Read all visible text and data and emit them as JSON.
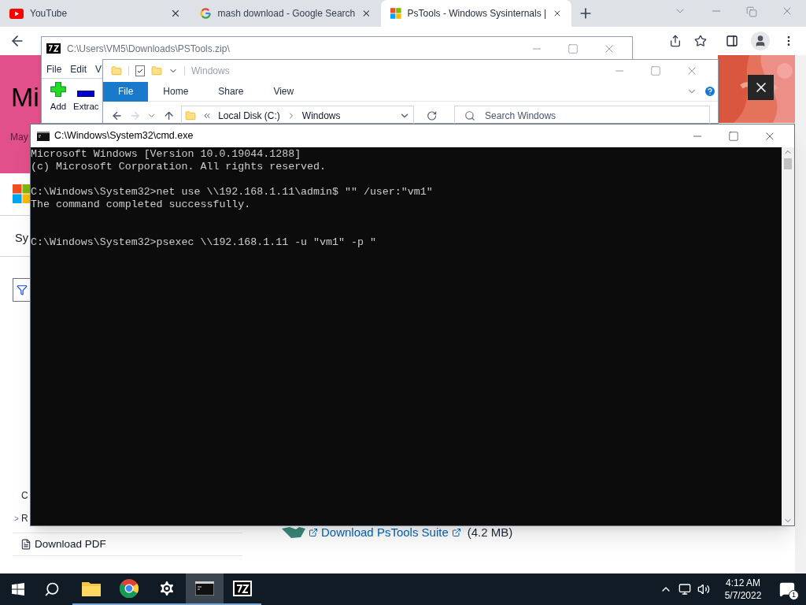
{
  "browser": {
    "tabs": [
      {
        "kind": "video",
        "title": "YouTube",
        "selected": false
      },
      {
        "kind": "search",
        "title": "mash download - Google Search",
        "selected": false
      },
      {
        "kind": "windows",
        "title": "PsTools - Windows Sysinternals |",
        "selected": true
      }
    ]
  },
  "page": {
    "heading": "Mi",
    "subtitle": "May",
    "section": "Sy",
    "nav_items": [
      {
        "label": "C"
      },
      {
        "marker": ">",
        "label": "R"
      }
    ],
    "download_pdf": "Download PDF",
    "download_link": "Download PsTools Suite",
    "download_size": "(4.2 MB)"
  },
  "zip_window": {
    "title": "C:\\Users\\VM5\\Downloads\\PSTools.zip\\",
    "menu": [
      "File",
      "Edit",
      "V"
    ],
    "toolbar": [
      {
        "kind": "add",
        "label": "Add"
      },
      {
        "kind": "extract",
        "label": "Extrac"
      }
    ]
  },
  "explorer": {
    "title": "Windows",
    "ribbon_tabs": [
      {
        "label": "File",
        "selected": true
      },
      {
        "label": "Home",
        "selected": false
      },
      {
        "label": "Share",
        "selected": false
      },
      {
        "label": "View",
        "selected": false
      }
    ],
    "breadcrumb": [
      "Local Disk (C:)",
      "Windows"
    ],
    "search": {
      "placeholder": "Search Windows"
    }
  },
  "console": {
    "title": "C:\\Windows\\System32\\cmd.exe",
    "output": "Microsoft Windows [Version 10.0.19044.1288]\n(c) Microsoft Corporation. All rights reserved.\n\nC:\\Windows\\System32>net use \\\\192.168.1.11\\admin$ \"\" /user:\"vm1\"\nThe command completed successfully.\n\n\nC:\\Windows\\System32>psexec \\\\192.168.1.11 -u \"vm1\" -p \""
  },
  "taskbar": {
    "apps": [
      {
        "kind": "folder",
        "selected": false
      },
      {
        "kind": "browser",
        "selected": false
      },
      {
        "kind": "settings",
        "selected": false
      },
      {
        "kind": "terminal",
        "selected": true
      },
      {
        "kind": "archive",
        "selected": false
      }
    ],
    "time": "4:12 AM",
    "date": "5/7/2022",
    "notifications": "1"
  }
}
